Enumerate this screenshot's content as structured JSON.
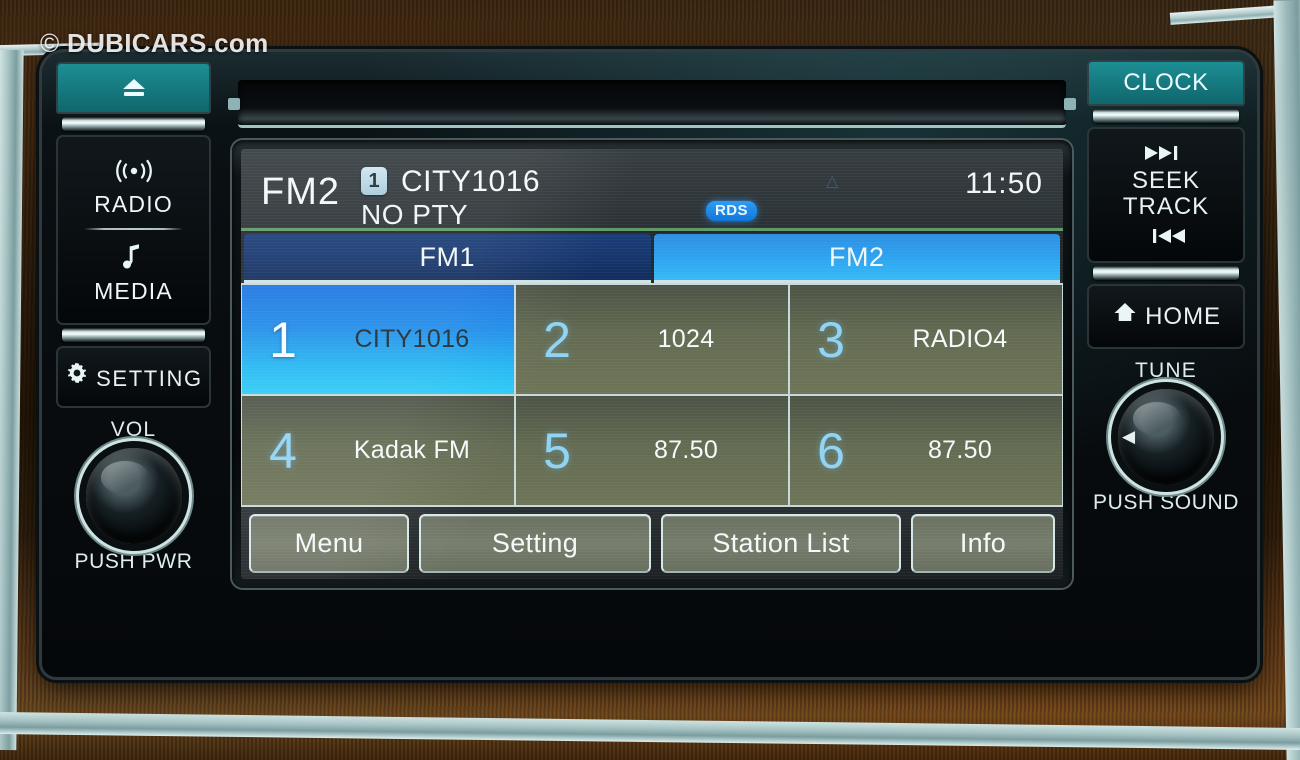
{
  "watermark": {
    "symbol": "©",
    "text": "DUBICARS.com"
  },
  "screen": {
    "header": {
      "band_label": "FM2",
      "preset_badge": "1",
      "station_name": "CITY1016",
      "pty": "NO PTY",
      "rds_badge": "RDS",
      "antenna_icon": "antenna-icon",
      "clock": "11:50"
    },
    "band_tabs": [
      {
        "label": "FM1",
        "active": false
      },
      {
        "label": "FM2",
        "active": true
      }
    ],
    "presets": [
      {
        "num": "1",
        "name": "CITY1016",
        "selected": true
      },
      {
        "num": "2",
        "name": "1024",
        "selected": false
      },
      {
        "num": "3",
        "name": "RADIO4",
        "selected": false
      },
      {
        "num": "4",
        "name": "Kadak FM",
        "selected": false
      },
      {
        "num": "5",
        "name": "87.50",
        "selected": false
      },
      {
        "num": "6",
        "name": "87.50",
        "selected": false
      }
    ],
    "softkeys": [
      {
        "label": "Menu"
      },
      {
        "label": "Setting"
      },
      {
        "label": "Station List"
      },
      {
        "label": "Info"
      }
    ]
  },
  "hardware": {
    "left": {
      "eject_icon": "eject-icon",
      "radio_icon": "radio-waves-icon",
      "radio_label": "RADIO",
      "media_icon": "music-note-icon",
      "media_label": "MEDIA",
      "setting_icon": "gear-icon",
      "setting_label": "SETTING",
      "knob_top_label": "VOL",
      "knob_bottom_label": "PUSH PWR"
    },
    "right": {
      "clock_label": "CLOCK",
      "seek_forward_icon": "skip-forward-icon",
      "seek_line1": "SEEK",
      "seek_line2": "TRACK",
      "seek_back_icon": "skip-back-icon",
      "home_icon": "home-icon",
      "home_label": "HOME",
      "knob_top_label": "TUNE",
      "knob_bottom_label": "PUSH SOUND"
    }
  },
  "colors": {
    "accent_teal": "#15787e",
    "accent_blue": "#24b7f2",
    "preset_number": "#8fd3f5",
    "header_rule_green": "#5e9a66",
    "rds_blue": "#1f8ce9",
    "softkey_olive": "#777d6c"
  }
}
